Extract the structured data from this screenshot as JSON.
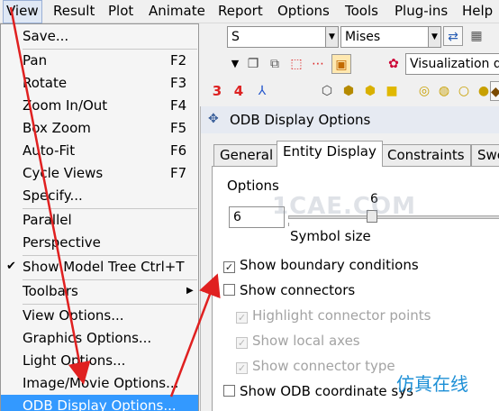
{
  "menubar": {
    "items": [
      {
        "label": "View",
        "selected": true
      },
      {
        "label": "Result"
      },
      {
        "label": "Plot"
      },
      {
        "label": "Animate"
      },
      {
        "label": "Report"
      },
      {
        "label": "Options"
      },
      {
        "label": "Tools"
      },
      {
        "label": "Plug-ins"
      },
      {
        "label": "Help"
      }
    ]
  },
  "toolbar": {
    "field_combo": "S",
    "invariant_combo": "Mises",
    "visualization_label": "Visualization d",
    "num3": "3",
    "num4": "4",
    "icons": [
      "refresh-icon",
      "grid-icon",
      "node-select-icon",
      "box-icon",
      "palette-icon",
      "cube-icons",
      "sphere-icons",
      "highlight-icon"
    ]
  },
  "view_menu": {
    "items": [
      {
        "label": "Save...",
        "accel": ""
      },
      {
        "label": "Pan",
        "accel": "F2"
      },
      {
        "label": "Rotate",
        "accel": "F3"
      },
      {
        "label": "Zoom In/Out",
        "accel": "F4"
      },
      {
        "label": "Box Zoom",
        "accel": "F5"
      },
      {
        "label": "Auto-Fit",
        "accel": "F6"
      },
      {
        "label": "Cycle Views",
        "accel": "F7"
      },
      {
        "label": "Specify...",
        "accel": ""
      },
      {
        "label": "Parallel",
        "accel": ""
      },
      {
        "label": "Perspective",
        "accel": ""
      },
      {
        "label": "Show Model Tree Ctrl+T",
        "accel": "",
        "checked": true
      },
      {
        "label": "Toolbars",
        "accel": "",
        "submenu": true
      },
      {
        "label": "View Options...",
        "accel": ""
      },
      {
        "label": "Graphics Options...",
        "accel": ""
      },
      {
        "label": "Light Options...",
        "accel": ""
      },
      {
        "label": "Image/Movie Options...",
        "accel": ""
      },
      {
        "label": "ODB Display Options...",
        "accel": "",
        "highlighted": true
      }
    ]
  },
  "dialog": {
    "title": "ODB Display Options",
    "tabs": [
      {
        "label": "General"
      },
      {
        "label": "Entity Display",
        "active": true
      },
      {
        "label": "Constraints"
      },
      {
        "label": "Swe"
      }
    ],
    "options_label": "Options",
    "symbol_size_value": "6",
    "slider_value": "6",
    "slider_fraction": 0.37,
    "symbol_size_label": "Symbol size",
    "checkboxes": [
      {
        "label": "Show boundary conditions",
        "checked": true,
        "enabled": true
      },
      {
        "label": "Show connectors",
        "checked": false,
        "enabled": true
      },
      {
        "label": "Highlight connector points",
        "checked": true,
        "enabled": false
      },
      {
        "label": "Show local axes",
        "checked": true,
        "enabled": false
      },
      {
        "label": "Show connector type",
        "checked": true,
        "enabled": false
      },
      {
        "label": "Show ODB coordinate sys",
        "checked": false,
        "enabled": true
      }
    ]
  },
  "watermarks": {
    "center": "1CAE.COM",
    "corner": "仿真在线"
  },
  "colors": {
    "highlight": "#3399ff",
    "arrow": "#e02020",
    "watermark_blue": "#1d8fd6"
  }
}
